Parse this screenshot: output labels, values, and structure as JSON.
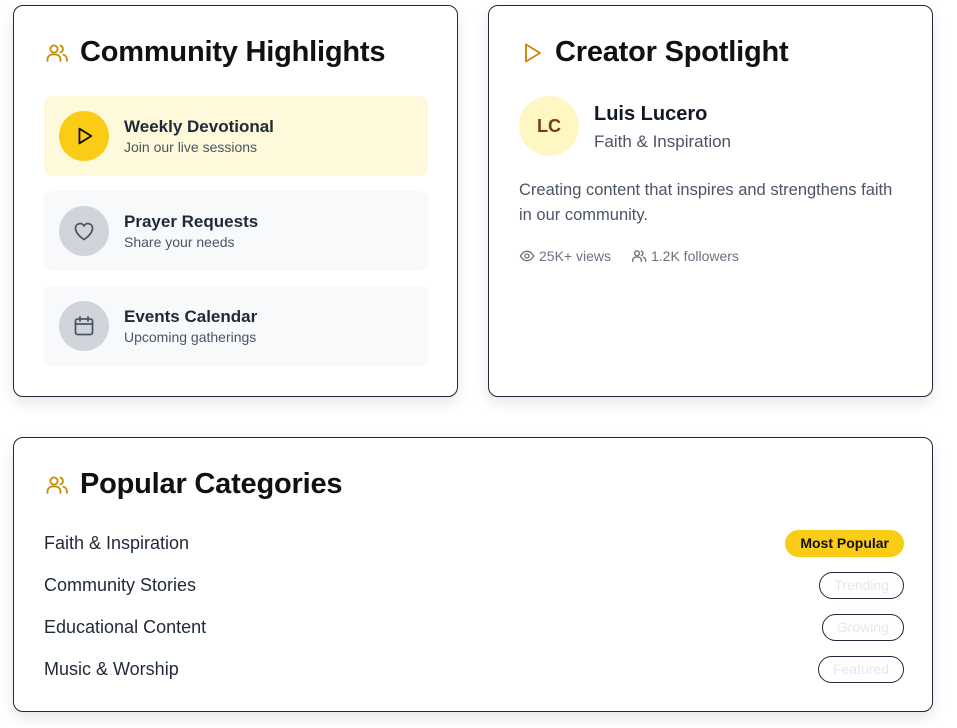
{
  "colors": {
    "accent": "#facc15",
    "accent_soft": "#fef9db",
    "icon_gold": "#ca8a04",
    "avatar_bg": "#fef7c3",
    "avatar_text": "#713f12"
  },
  "community_highlights": {
    "title": "Community Highlights",
    "icon": "users-icon",
    "items": [
      {
        "title": "Weekly Devotional",
        "subtitle": "Join our live sessions",
        "icon": "play-icon",
        "active": true
      },
      {
        "title": "Prayer Requests",
        "subtitle": "Share your needs",
        "icon": "heart-icon",
        "active": false
      },
      {
        "title": "Events Calendar",
        "subtitle": "Upcoming gatherings",
        "icon": "calendar-icon",
        "active": false
      }
    ]
  },
  "creator_spotlight": {
    "title": "Creator Spotlight",
    "icon": "play-icon",
    "avatar_initials": "LC",
    "name": "Luis Lucero",
    "category": "Faith & Inspiration",
    "description": "Creating content that inspires and strengthens faith in our community.",
    "views": "25K+ views",
    "followers": "1.2K followers"
  },
  "popular_categories": {
    "title": "Popular Categories",
    "icon": "users-icon",
    "items": [
      {
        "name": "Faith & Inspiration",
        "badge": "Most Popular"
      },
      {
        "name": "Community Stories",
        "badge": "Trending"
      },
      {
        "name": "Educational Content",
        "badge": "Growing"
      },
      {
        "name": "Music & Worship",
        "badge": "Featured"
      }
    ]
  }
}
